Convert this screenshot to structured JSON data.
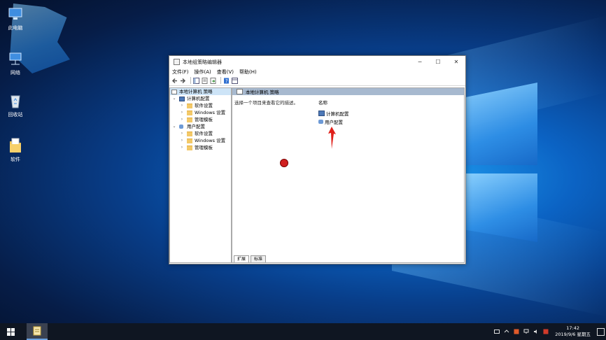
{
  "desktop": {
    "icons": [
      {
        "label": "此电脑",
        "icon": "computer-icon"
      },
      {
        "label": "网络",
        "icon": "network-icon"
      },
      {
        "label": "回收站",
        "icon": "recycle-bin-icon"
      },
      {
        "label": "软件",
        "icon": "folder-icon"
      }
    ]
  },
  "window": {
    "title": "本地组策略编辑器",
    "controls": {
      "minimize": "─",
      "maximize": "☐",
      "close": "✕"
    },
    "menu": [
      "文件(F)",
      "操作(A)",
      "查看(V)",
      "帮助(H)"
    ],
    "tree": {
      "root": "本地计算机 策略",
      "computer_config": "计算机配置",
      "computer_children": [
        "软件设置",
        "Windows 设置",
        "管理模板"
      ],
      "user_config": "用户配置",
      "user_children": [
        "软件设置",
        "Windows 设置",
        "管理模板"
      ]
    },
    "right": {
      "header": "本地计算机 策略",
      "description": "选择一个项目来查看它的描述。",
      "column_name": "名称",
      "items": [
        "计算机配置",
        "用户配置"
      ]
    },
    "tabs": [
      "扩展",
      "标准"
    ]
  },
  "taskbar": {
    "time": "17:42",
    "date": "2019/9/6 星期五"
  }
}
